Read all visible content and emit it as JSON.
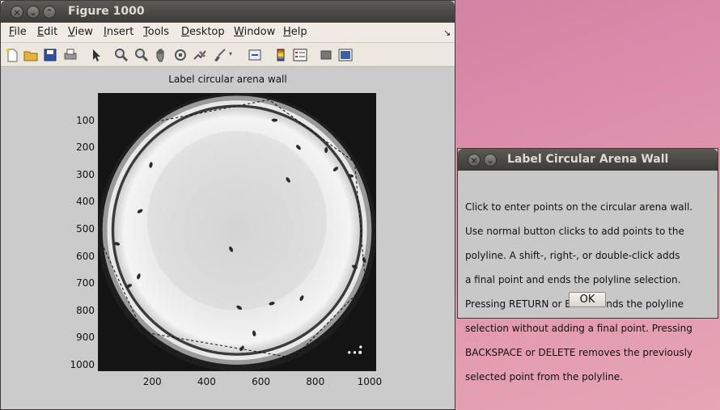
{
  "figure_window": {
    "title": "Figure 1000",
    "menus": [
      "File",
      "Edit",
      "View",
      "Insert",
      "Tools",
      "Desktop",
      "Window",
      "Help"
    ],
    "menu_underline": [
      "F",
      "E",
      "V",
      "I",
      "T",
      "D",
      "W",
      "H"
    ],
    "toolbar_icons": [
      "new-file-icon",
      "open-folder-icon",
      "save-icon",
      "print-icon",
      "pointer-icon",
      "zoom-in-icon",
      "zoom-out-icon",
      "pan-hand-icon",
      "rotate-icon",
      "data-cursor-icon",
      "brush-icon",
      "link-icon",
      "colorbar-icon",
      "legend-icon",
      "hide-plot-tools-icon",
      "show-plot-tools-icon"
    ],
    "axes": {
      "title": "Label circular arena wall",
      "yticks": [
        "100",
        "200",
        "300",
        "400",
        "500",
        "600",
        "700",
        "800",
        "900",
        "1000"
      ],
      "xticks": [
        "200",
        "400",
        "600",
        "800",
        "1000"
      ]
    }
  },
  "dialog": {
    "title": "Label Circular Arena Wall",
    "lines": [
      "Click to enter points on the circular arena wall.",
      "Use normal button clicks to add points to the",
      "polyline.  A shift-, right-, or double-click adds",
      "a final point and ends the polyline selection.",
      "Pressing RETURN or ENTER ends the polyline",
      "selection without adding a final point.  Pressing",
      "BACKSPACE or DELETE removes the previously",
      "selected point from the polyline."
    ],
    "ok_label": "OK"
  },
  "polyline_points": [
    [
      215,
      105
    ],
    [
      630,
      25
    ],
    [
      945,
      255
    ],
    [
      985,
      705
    ],
    [
      720,
      975
    ],
    [
      165,
      880
    ],
    [
      15,
      555
    ]
  ],
  "flies": [
    [
      650,
      100
    ],
    [
      738,
      200
    ],
    [
      840,
      210
    ],
    [
      875,
      280
    ],
    [
      930,
      305
    ],
    [
      700,
      320
    ],
    [
      195,
      265
    ],
    [
      155,
      435
    ],
    [
      70,
      555
    ],
    [
      490,
      575
    ],
    [
      150,
      675
    ],
    [
      115,
      710
    ],
    [
      945,
      640
    ],
    [
      980,
      615
    ],
    [
      750,
      755
    ],
    [
      640,
      775
    ],
    [
      520,
      790
    ],
    [
      575,
      885
    ],
    [
      530,
      940
    ]
  ]
}
